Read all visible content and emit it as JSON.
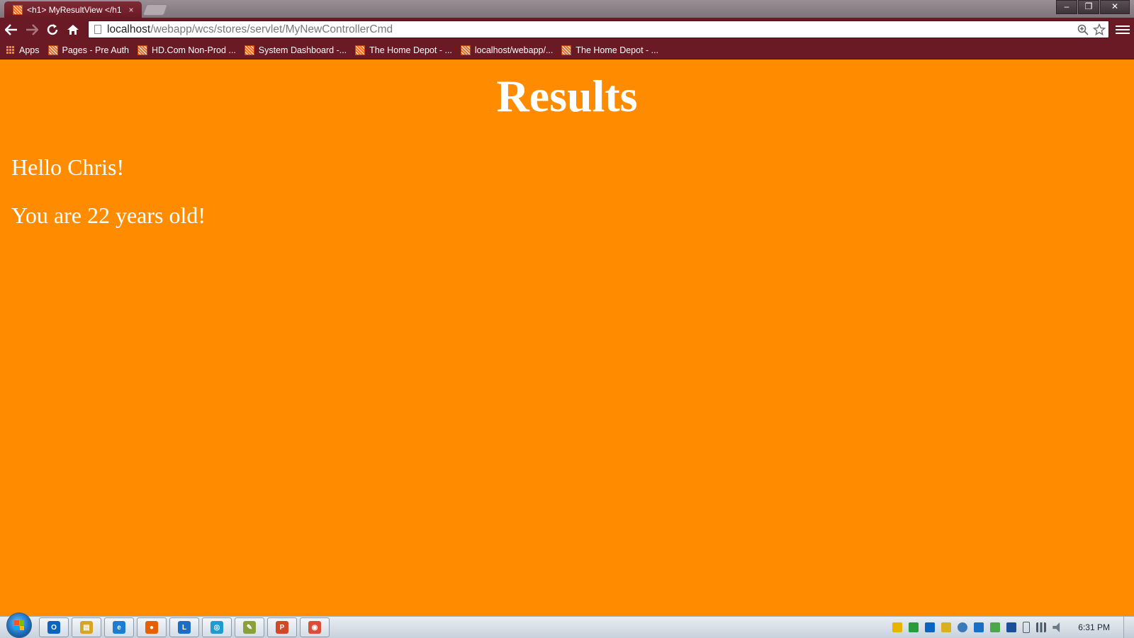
{
  "browser": {
    "tab": {
      "title": "<h1> MyResultView </h1",
      "close_icon": "×"
    },
    "window_controls": {
      "minimize": "–",
      "restore": "❐",
      "close": "✕"
    },
    "toolbar": {
      "back": "←",
      "forward": "→",
      "reload": "↻",
      "home": "⌂"
    },
    "omnibox": {
      "host": "localhost",
      "path": "/webapp/wcs/stores/servlet/MyNewControllerCmd",
      "zoom_icon": "⊕",
      "star_icon": "☆"
    },
    "bookmarks": [
      {
        "label": "Apps"
      },
      {
        "label": "Pages - Pre Auth"
      },
      {
        "label": "HD.Com Non-Prod ..."
      },
      {
        "label": "System Dashboard -..."
      },
      {
        "label": "The Home Depot - ..."
      },
      {
        "label": "localhost/webapp/..."
      },
      {
        "label": "The Home Depot - ..."
      }
    ]
  },
  "page": {
    "heading": "Results",
    "greeting": "Hello Chris!",
    "age_message": "You are 22 years old!",
    "background_color": "#ff8c00"
  },
  "taskbar": {
    "apps": [
      {
        "name": "outlook",
        "glyph": "O",
        "color": "#0a64c0"
      },
      {
        "name": "explorer",
        "glyph": "▤",
        "color": "#d9a520"
      },
      {
        "name": "internet-explorer",
        "glyph": "e",
        "color": "#1b7ed3"
      },
      {
        "name": "firefox",
        "glyph": "●",
        "color": "#e66000"
      },
      {
        "name": "lync",
        "glyph": "L",
        "color": "#1a6fc4"
      },
      {
        "name": "target-app",
        "glyph": "◎",
        "color": "#1f9bd1"
      },
      {
        "name": "notepad",
        "glyph": "✎",
        "color": "#8aa03a"
      },
      {
        "name": "powerpoint",
        "glyph": "P",
        "color": "#d24726"
      },
      {
        "name": "chrome",
        "glyph": "◉",
        "color": "#dd4b39"
      }
    ],
    "clock": "6:31 PM"
  }
}
